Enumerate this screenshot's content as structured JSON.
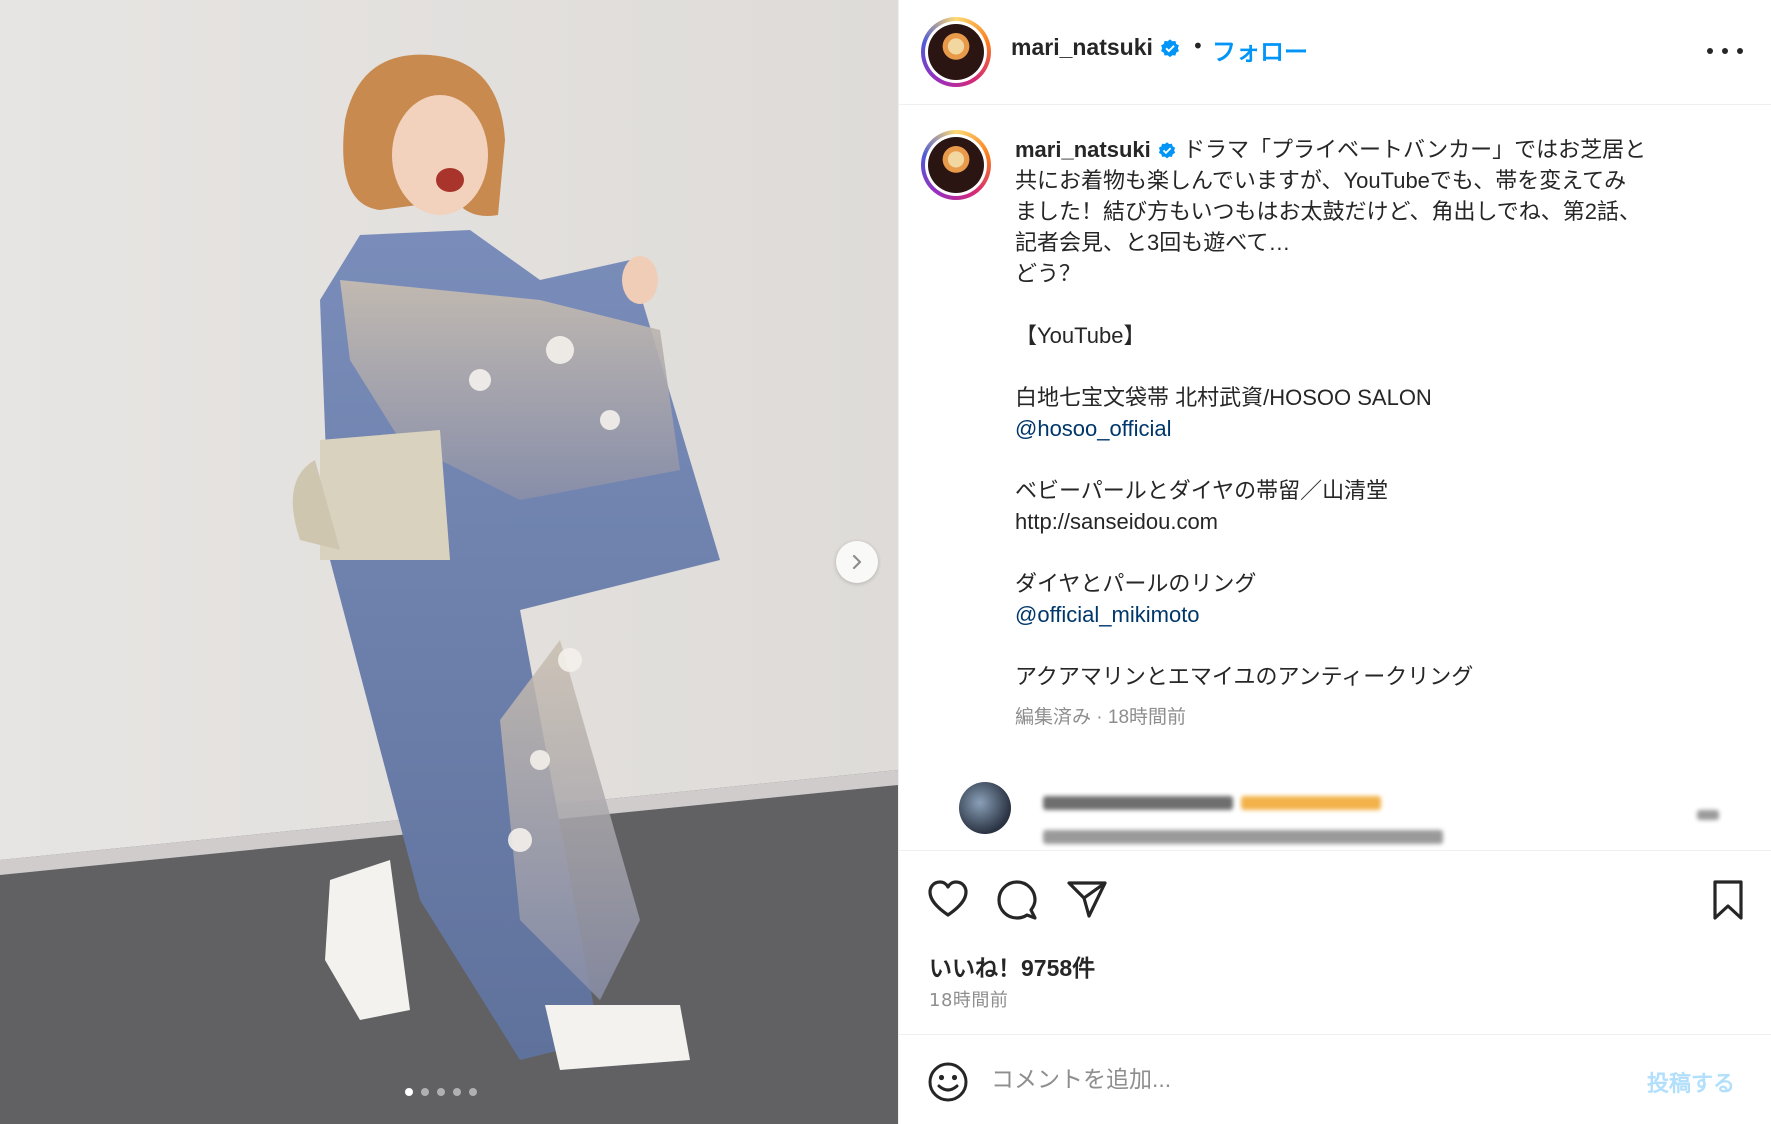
{
  "media": {
    "slide_count": 5,
    "active_slide": 1,
    "next_icon": "chevron-right-icon"
  },
  "header": {
    "username": "mari_natsuki",
    "separator": "•",
    "follow_label": "フォロー",
    "more_icon": "more-horizontal-icon"
  },
  "caption": {
    "username": "mari_natsuki",
    "lines": [
      "ドラマ「プライベートバンカー」ではお芝居と",
      "共にお着物も楽しんでいますが、YouTubeでも、帯を変えてみ",
      "ました！結び方もいつもはお太鼓だけど、角出しでね、第2話、",
      "記者会見、と3回も遊べて…",
      "どう？"
    ],
    "youtube_heading": "【YouTube】",
    "item1": "白地七宝文袋帯 北村武資/HOSOO SALON",
    "item1_link": "@hosoo_official",
    "item2": "ベビーパールとダイヤの帯留／山清堂",
    "item2_link": "http://sanseidou.com",
    "item3": "ダイヤとパールのリング",
    "item3_link": "@official_mikimoto",
    "item4": "アクアマリンとエマイユのアンティークリング",
    "meta": "編集済み · 18時間前"
  },
  "actions": {
    "likes": "いいね！9758件",
    "time": "18時間前"
  },
  "comment": {
    "placeholder": "コメントを追加...",
    "post_label": "投稿する"
  },
  "colors": {
    "accent": "#0095f6",
    "link": "#00376b",
    "muted": "#8e8e8e",
    "post_disabled": "#b2dffc",
    "kimono": "#6e82ad"
  }
}
